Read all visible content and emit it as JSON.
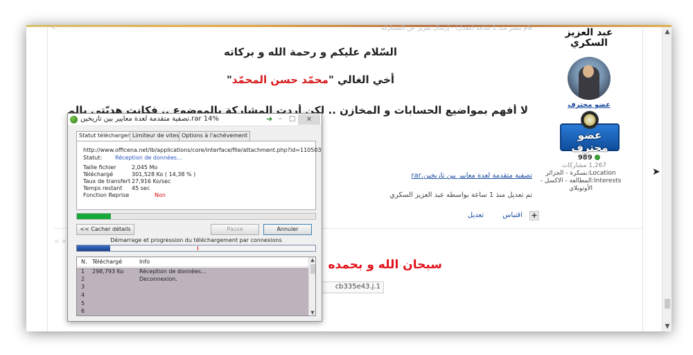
{
  "post": {
    "edit_note_top": "قام بنشر منذ 1 ساعة (معدل) · إرسال تقرير عن المشاركة",
    "greeting": "السّلام عليكم و رحمة الله و بركاته",
    "brother_prefix": "أخي الغالي \"",
    "brother_name": "محمّد حسن المحمّد",
    "brother_suffix": "\"",
    "understand_line": "لا أفهم بمواضيع الحسابات و المخازن .. لكن أردت المشاركة بالموضوع .. فكانت هديّتي بالملف المرفق .",
    "attachment_link": "تصفية متقدمة لعدة معايير بين تاريخين.rar",
    "edited_by": "تم تعديل منذ 1 ساعة بواسطه عبد العزيز السكري",
    "quote_label": "اقتباس",
    "edit_label": "تعديل",
    "plus_label": "+",
    "subhan": "سبحان الله و بحمده",
    "file_tag": "cb335e43.j.1"
  },
  "sidebar": {
    "username": "عبد العزيز السكري",
    "rank_link": "عضو محترف",
    "rank_badge": "عضو محترف",
    "reputation": "989",
    "posts_count": "1,267 مشاركات",
    "location": "Location:بسكرة - الجزائر",
    "interests": "Interests:المطالعة - الاكسل - الأوتوبلاي"
  },
  "dialog": {
    "title": "تصفية متقدمة لعدة معايير بين تاريخين.rar 14%",
    "tabs": [
      "Statut téléchargement",
      "Limiteur de vitesse",
      "Options à l'achèvement"
    ],
    "url": "http://www.officena.net/lb/applications/core/interface/file/attachment.php?id=110503",
    "status_label": "Statut:",
    "status_value": "Réception de données...",
    "size_label": "Taille fichier",
    "size_value": "2,045  Mo",
    "downloaded_label": "Téléchargé",
    "downloaded_value": "301,528  Ko  ( 14,38 % )",
    "rate_label": "Taux de transfert",
    "rate_value": "27,916  Ko/sec",
    "time_label": "Temps restant",
    "time_value": "45 sec",
    "resume_label": "Fonction Reprise",
    "resume_value": "Non",
    "progress_fraction": 0.1438,
    "hide_details_label": "<< Cacher détails",
    "pause_label": "Pause",
    "cancel_label": "Annuler",
    "connections_caption": "Démarrage et progression du téléchargement par connexions",
    "connections_fraction": 0.14,
    "table_headers": [
      "N.",
      "Téléchargé",
      "Info"
    ],
    "rows": [
      {
        "n": "1",
        "downloaded": "298,793  Ko",
        "info": "Réception de données..."
      },
      {
        "n": "2",
        "downloaded": "",
        "info": "Deconnexion."
      },
      {
        "n": "3",
        "downloaded": "",
        "info": ""
      },
      {
        "n": "4",
        "downloaded": "",
        "info": ""
      },
      {
        "n": "5",
        "downloaded": "",
        "info": ""
      },
      {
        "n": "6",
        "downloaded": "",
        "info": ""
      }
    ]
  },
  "colors": {
    "accent_red": "#d8181b",
    "link_blue": "#1a4aa0",
    "progress_green": "#17a83a"
  }
}
